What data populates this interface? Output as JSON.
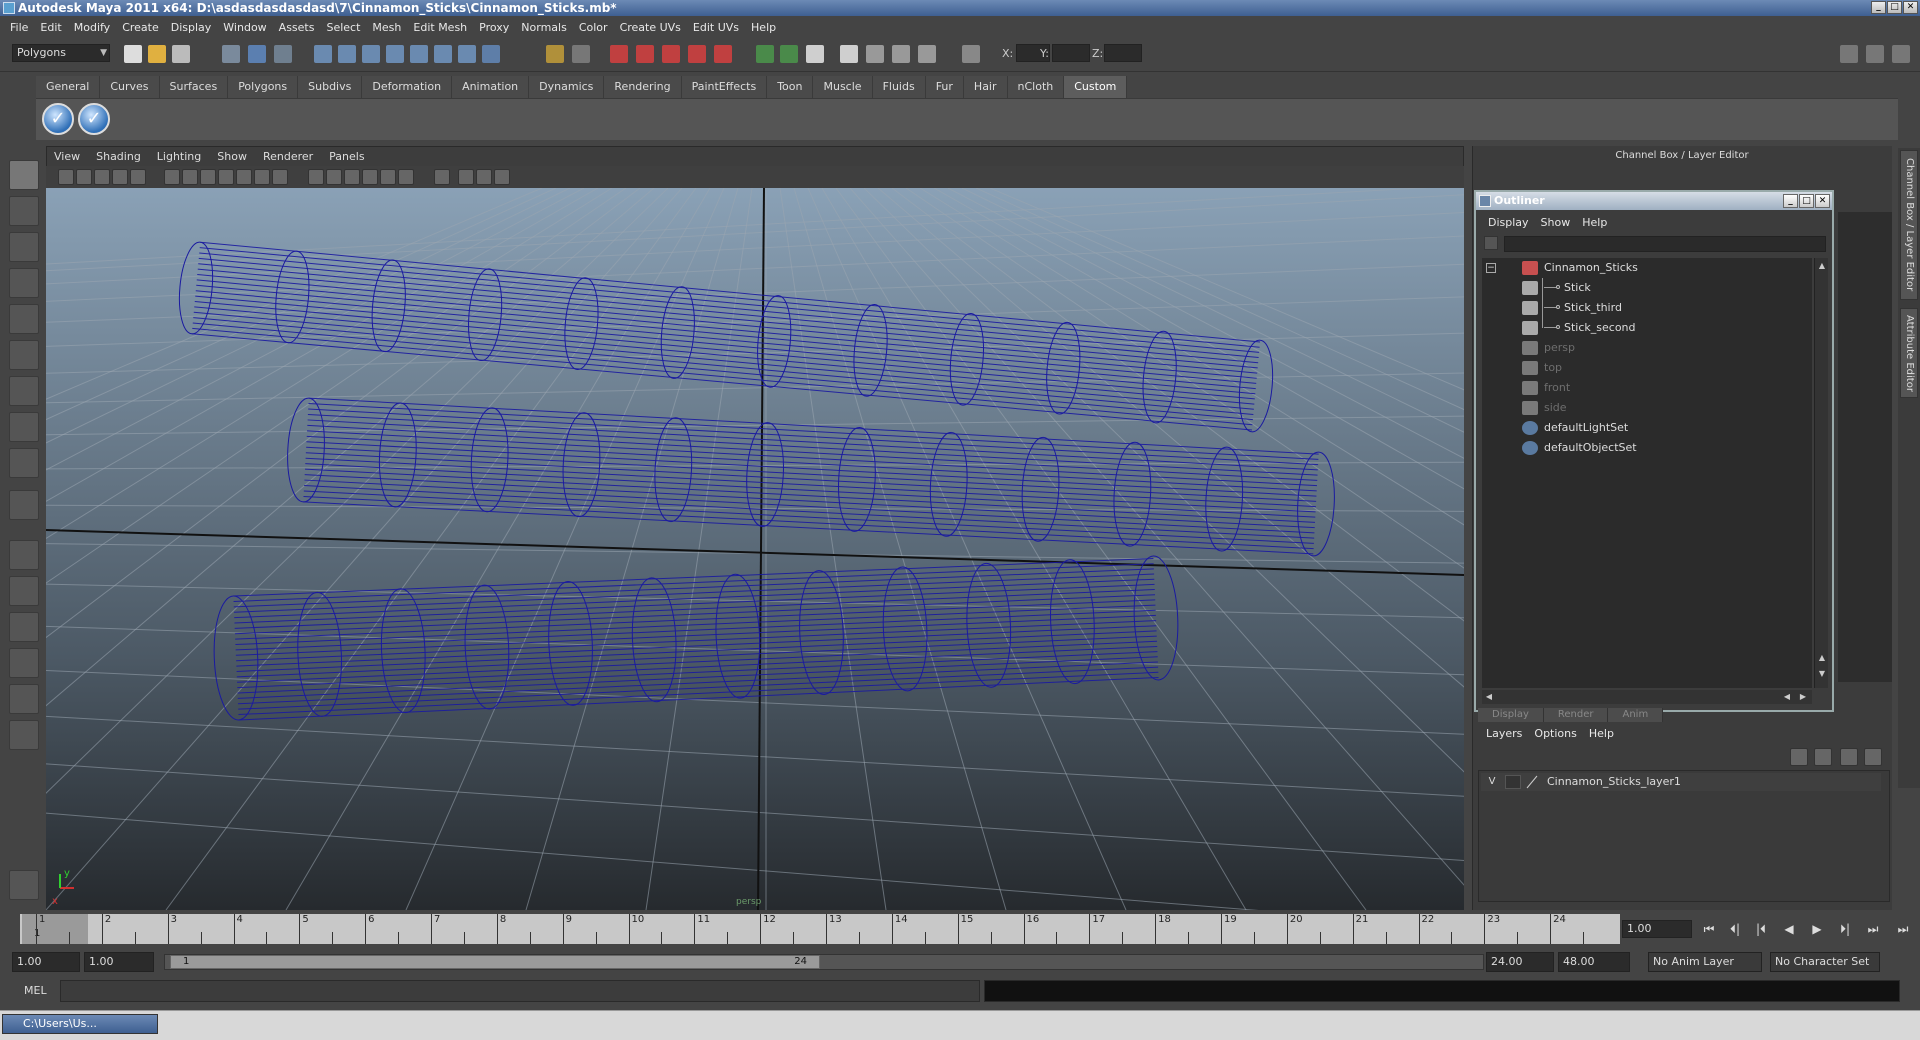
{
  "window": {
    "title": "Autodesk Maya 2011 x64: D:\\asdasdasdasdasd\\7\\Cinnamon_Sticks\\Cinnamon_Sticks.mb*",
    "min": "_",
    "max": "□",
    "close": "✕"
  },
  "menubar": [
    "File",
    "Edit",
    "Modify",
    "Create",
    "Display",
    "Window",
    "Assets",
    "Select",
    "Mesh",
    "Edit Mesh",
    "Proxy",
    "Normals",
    "Color",
    "Create UVs",
    "Edit UVs",
    "Help"
  ],
  "statusline": {
    "mode": "Polygons",
    "x_label": "X:",
    "y_label": "Y:",
    "z_label": "Z:"
  },
  "shelf": {
    "tabs": [
      "General",
      "Curves",
      "Surfaces",
      "Polygons",
      "Subdivs",
      "Deformation",
      "Animation",
      "Dynamics",
      "Rendering",
      "PaintEffects",
      "Toon",
      "Muscle",
      "Fluids",
      "Fur",
      "Hair",
      "nCloth",
      "Custom"
    ],
    "active_tab": "Custom",
    "button_glyph": "✓"
  },
  "viewport": {
    "menu": [
      "View",
      "Shading",
      "Lighting",
      "Show",
      "Renderer",
      "Panels"
    ],
    "wire_color": "#1a1aa0",
    "axis_x": "x",
    "axis_y": "y",
    "camera_label": "persp"
  },
  "channelbox": {
    "title": "Channel Box / Layer Editor",
    "side_tabs": [
      "Channel Box / Layer Editor",
      "Attribute Editor"
    ]
  },
  "outliner": {
    "title": "Outliner",
    "menu": [
      "Display",
      "Show",
      "Help"
    ],
    "expand_glyph": "−",
    "items": [
      {
        "label": "Cinnamon_Sticks",
        "indent": 0,
        "dim": false,
        "expanded": true
      },
      {
        "label": "Stick",
        "indent": 1,
        "dim": false
      },
      {
        "label": "Stick_third",
        "indent": 1,
        "dim": false
      },
      {
        "label": "Stick_second",
        "indent": 1,
        "dim": false
      },
      {
        "label": "persp",
        "indent": 0,
        "dim": true
      },
      {
        "label": "top",
        "indent": 0,
        "dim": true
      },
      {
        "label": "front",
        "indent": 0,
        "dim": true
      },
      {
        "label": "side",
        "indent": 0,
        "dim": true
      },
      {
        "label": "defaultLightSet",
        "indent": 0,
        "dim": false
      },
      {
        "label": "defaultObjectSet",
        "indent": 0,
        "dim": false
      }
    ]
  },
  "layers": {
    "tabs": [
      "Display",
      "Render",
      "Anim"
    ],
    "menu": [
      "Layers",
      "Options",
      "Help"
    ],
    "rows": [
      {
        "visible": "V",
        "name": "Cinnamon_Sticks_layer1"
      }
    ]
  },
  "timeline": {
    "start": 1,
    "end": 24,
    "current_frame_label": "1",
    "current_frame": "1.00",
    "playback_glyphs": [
      "⏮",
      "⏴|",
      "|⏴",
      "◀",
      "▶",
      "⏵|",
      "⏭",
      "⏭"
    ]
  },
  "range": {
    "start_time": "1.00",
    "playback_start": "1.00",
    "handle_start": "1",
    "handle_end": "24",
    "playback_end": "24.00",
    "end_time": "48.00",
    "anim_layer": "No Anim Layer",
    "character_set": "No Character Set"
  },
  "commandline": {
    "label": "MEL"
  },
  "taskbar": {
    "item": "C:\\Users\\Us..."
  }
}
